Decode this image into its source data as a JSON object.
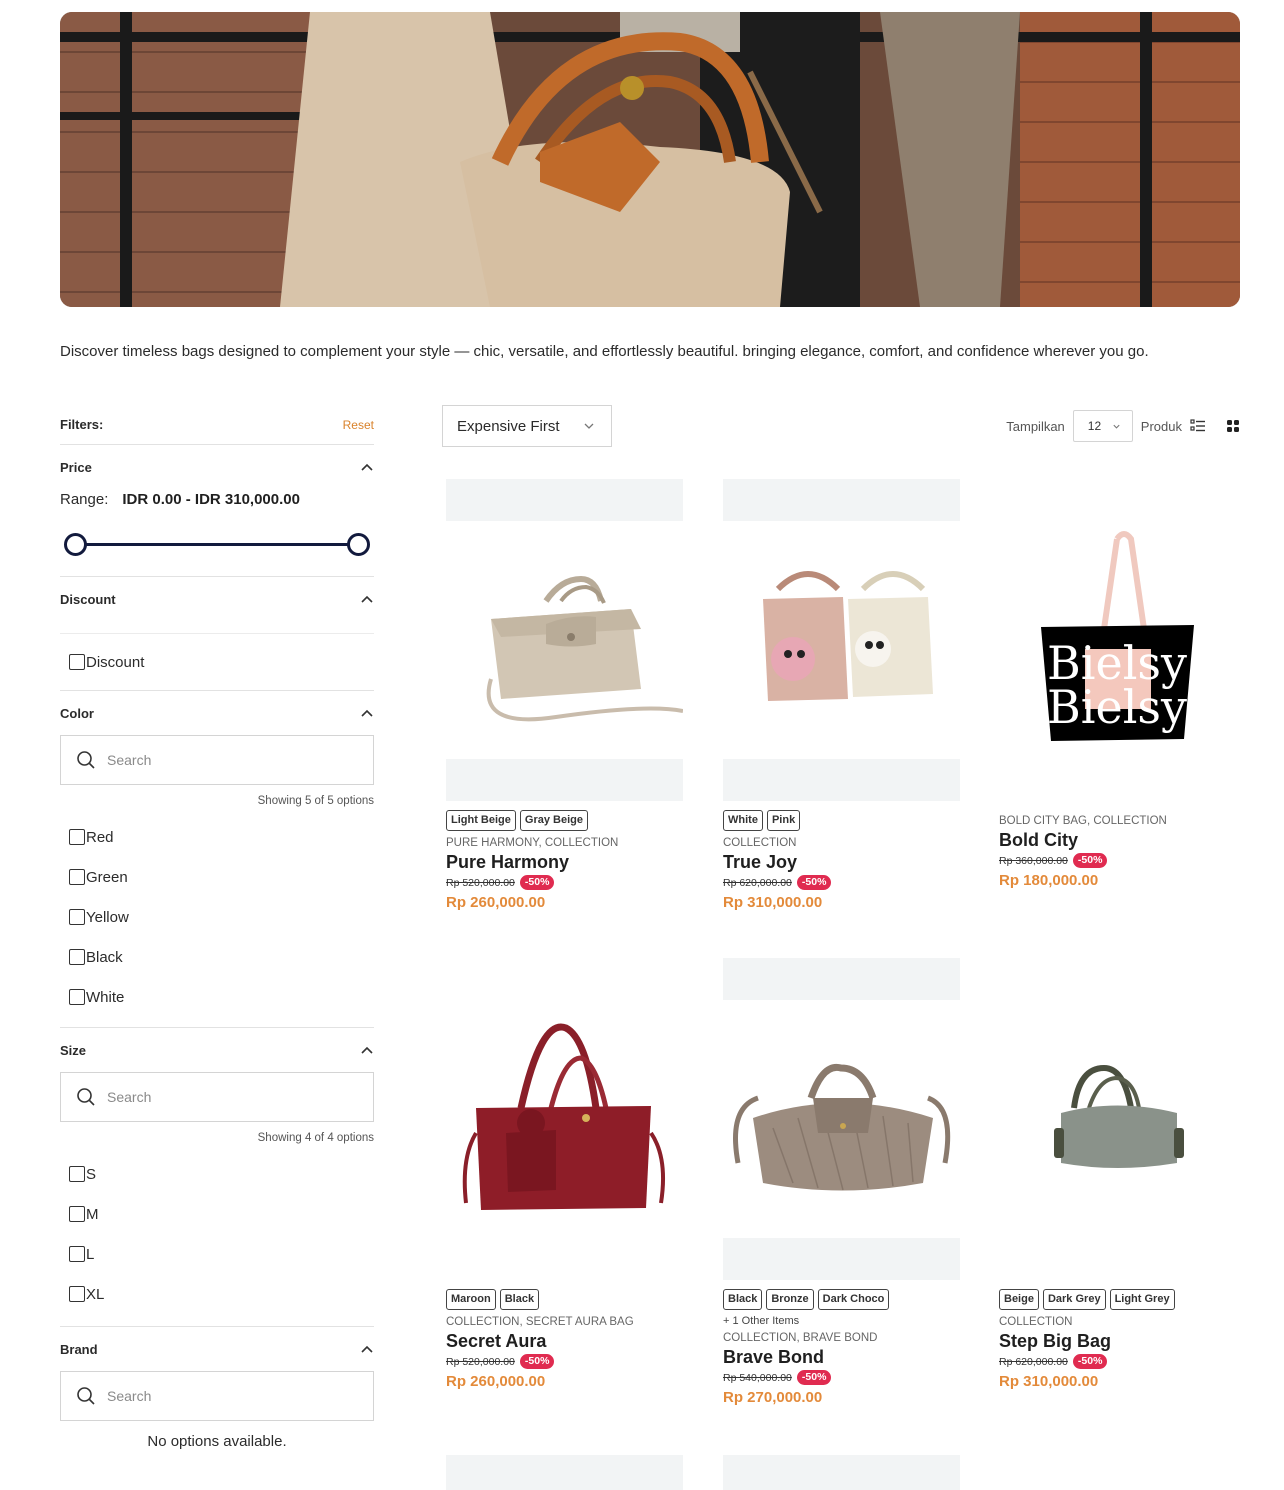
{
  "intro": "Discover timeless bags designed to complement your style — chic, versatile, and effortlessly beautiful. bringing elegance, comfort, and confidence wherever you go.",
  "filters": {
    "title": "Filters:",
    "reset": "Reset",
    "price": {
      "label": "Price",
      "range_label": "Range:",
      "range_value": "IDR 0.00 - IDR 310,000.00",
      "min_fraction": 0,
      "max_fraction": 1
    },
    "discount": {
      "label": "Discount",
      "option": "Discount"
    },
    "color": {
      "label": "Color",
      "placeholder": "Search",
      "showing": "Showing 5 of 5 options",
      "options": [
        "Red",
        "Green",
        "Yellow",
        "Black",
        "White"
      ]
    },
    "size": {
      "label": "Size",
      "placeholder": "Search",
      "showing": "Showing 4 of 4 options",
      "options": [
        "S",
        "M",
        "L",
        "XL"
      ]
    },
    "brand": {
      "label": "Brand",
      "placeholder": "Search",
      "empty": "No options available."
    }
  },
  "toolbar": {
    "sort": "Expensive First",
    "show_label": "Tampilkan",
    "per_page": "12",
    "unit_label": "Produk"
  },
  "products": [
    {
      "tags": [
        "Light Beige",
        "Gray Beige"
      ],
      "more": "",
      "collection": "PURE HARMONY, COLLECTION",
      "name": "Pure Harmony",
      "old_price": "Rp 520,000.00",
      "discount": "-50%",
      "price": "Rp 260,000.00",
      "icon": "beige-handbag-image"
    },
    {
      "tags": [
        "White",
        "Pink"
      ],
      "more": "",
      "collection": "COLLECTION",
      "name": "True Joy",
      "old_price": "Rp 620,000.00",
      "discount": "-50%",
      "price": "Rp 310,000.00",
      "icon": "pink-white-totes-image"
    },
    {
      "tags": [],
      "more": "",
      "collection": "BOLD CITY BAG, COLLECTION",
      "name": "Bold City",
      "old_price": "Rp 360,000.00",
      "discount": "-50%",
      "price": "Rp 180,000.00",
      "icon": "black-tote-image",
      "print": "Bielsy"
    },
    {
      "tags": [
        "Maroon",
        "Black"
      ],
      "more": "",
      "collection": "COLLECTION, SECRET AURA BAG",
      "name": "Secret Aura",
      "old_price": "Rp 520,000.00",
      "discount": "-50%",
      "price": "Rp 260,000.00",
      "icon": "maroon-handbag-image"
    },
    {
      "tags": [
        "Black",
        "Bronze",
        "Dark Choco"
      ],
      "more": "+ 1 Other Items",
      "collection": "COLLECTION, BRAVE BOND",
      "name": "Brave Bond",
      "old_price": "Rp 540,000.00",
      "discount": "-50%",
      "price": "Rp 270,000.00",
      "icon": "bronze-woven-bag-image"
    },
    {
      "tags": [
        "Beige",
        "Dark Grey",
        "Light Grey"
      ],
      "more": "",
      "collection": "COLLECTION",
      "name": "Step Big Bag",
      "old_price": "Rp 620,000.00",
      "discount": "-50%",
      "price": "Rp 310,000.00",
      "icon": "grey-duffel-bag-image"
    }
  ],
  "colors": {
    "accent": "#e38a3a",
    "discount_badge": "#e02b50",
    "slider": "#121a3d"
  }
}
